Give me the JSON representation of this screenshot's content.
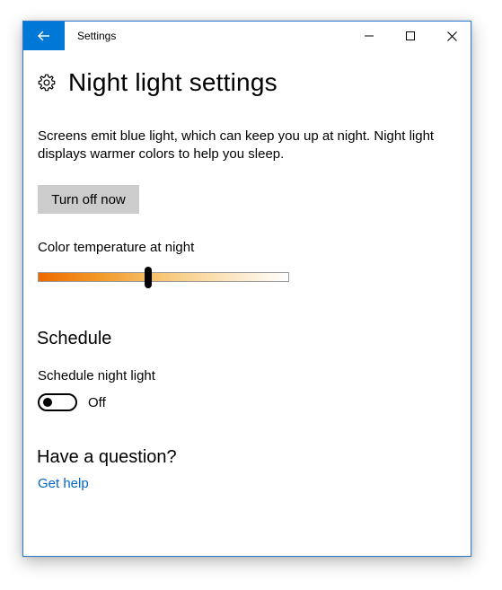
{
  "window": {
    "title": "Settings",
    "accent_color": "#0078d7",
    "controls": {
      "back_icon": "back-arrow-icon",
      "minimize_icon": "minimize-icon",
      "maximize_icon": "maximize-icon",
      "close_icon": "close-icon"
    }
  },
  "page": {
    "icon": "gear-icon",
    "title": "Night light settings",
    "description": "Screens emit blue light, which can keep you up at night. Night light displays warmer colors to help you sleep.",
    "turn_off_button": "Turn off now"
  },
  "color_temperature": {
    "label": "Color temperature at night",
    "level_fraction": 0.44,
    "gradient_start_color": "#f06a00",
    "gradient_end_color": "#ffffff"
  },
  "schedule": {
    "heading": "Schedule",
    "toggle_label": "Schedule night light",
    "toggle_state": "Off",
    "toggle_on": false
  },
  "help": {
    "heading": "Have a question?",
    "link_text": "Get help",
    "link_color": "#0066cc"
  }
}
